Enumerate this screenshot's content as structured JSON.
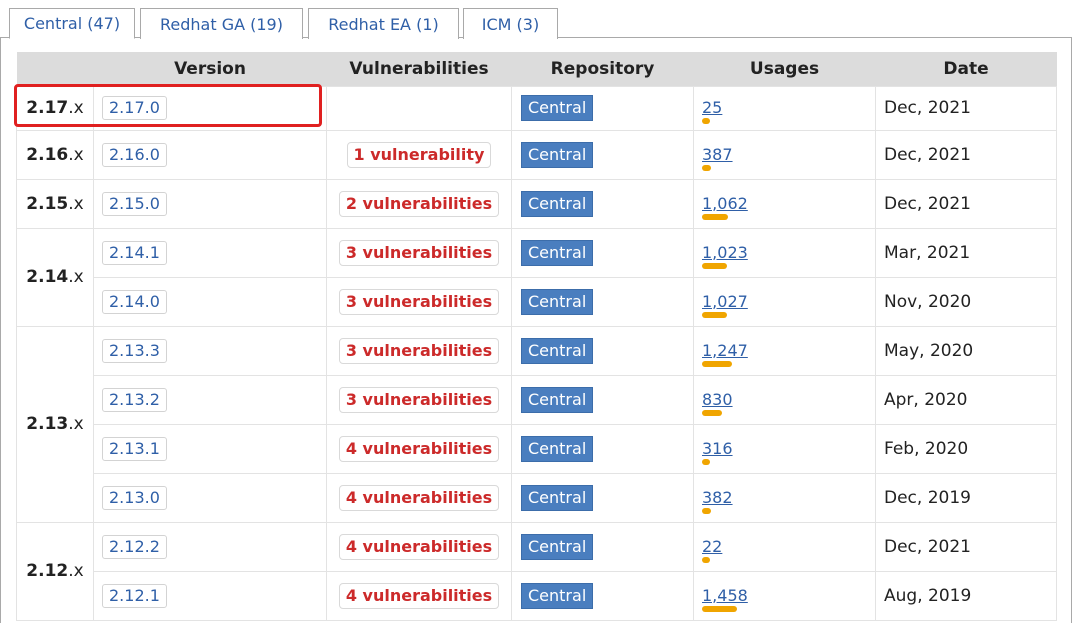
{
  "tabs": [
    {
      "label": "Central (47)"
    },
    {
      "label": "Redhat GA (19)"
    },
    {
      "label": "Redhat EA (1)"
    },
    {
      "label": "ICM (3)"
    }
  ],
  "table": {
    "headers": [
      "Version",
      "Vulnerabilities",
      "Repository",
      "Usages",
      "Date"
    ],
    "rows": [
      {
        "minor": "2.17",
        "version": "2.17.0",
        "vuln": "",
        "repo": "Central",
        "usages": "25",
        "usage_fraction": 0.02,
        "date": "Dec, 2021"
      },
      {
        "minor": "2.16",
        "version": "2.16.0",
        "vuln": "1 vulnerability",
        "repo": "Central",
        "usages": "387",
        "usage_fraction": 0.27,
        "date": "Dec, 2021"
      },
      {
        "minor": "2.15",
        "version": "2.15.0",
        "vuln": "2 vulnerabilities",
        "repo": "Central",
        "usages": "1,062",
        "usage_fraction": 0.73,
        "date": "Dec, 2021"
      },
      {
        "minor": "2.14",
        "version": "2.14.1",
        "vuln": "3 vulnerabilities",
        "repo": "Central",
        "usages": "1,023",
        "usage_fraction": 0.7,
        "date": "Mar, 2021"
      },
      {
        "minor": "",
        "version": "2.14.0",
        "vuln": "3 vulnerabilities",
        "repo": "Central",
        "usages": "1,027",
        "usage_fraction": 0.7,
        "date": "Nov, 2020"
      },
      {
        "minor": "2.13",
        "version": "2.13.3",
        "vuln": "3 vulnerabilities",
        "repo": "Central",
        "usages": "1,247",
        "usage_fraction": 0.86,
        "date": "May, 2020"
      },
      {
        "minor": "",
        "version": "2.13.2",
        "vuln": "3 vulnerabilities",
        "repo": "Central",
        "usages": "830",
        "usage_fraction": 0.57,
        "date": "Apr, 2020"
      },
      {
        "minor": "",
        "version": "2.13.1",
        "vuln": "4 vulnerabilities",
        "repo": "Central",
        "usages": "316",
        "usage_fraction": 0.22,
        "date": "Feb, 2020"
      },
      {
        "minor": "",
        "version": "2.13.0",
        "vuln": "4 vulnerabilities",
        "repo": "Central",
        "usages": "382",
        "usage_fraction": 0.26,
        "date": "Dec, 2019"
      },
      {
        "minor": "2.12",
        "version": "2.12.2",
        "vuln": "4 vulnerabilities",
        "repo": "Central",
        "usages": "22",
        "usage_fraction": 0.015,
        "date": "Dec, 2021"
      },
      {
        "minor": "",
        "version": "2.12.1",
        "vuln": "4 vulnerabilities",
        "repo": "Central",
        "usages": "1,458",
        "usage_fraction": 1.0,
        "date": "Aug, 2019"
      }
    ],
    "minor_suffix": ".x"
  },
  "colors": {
    "link": "#2f5fa7",
    "vuln": "#cc2a2a",
    "repo_badge": "#4a7ebf",
    "usage_bar": "#f0a500",
    "highlight": "#e02020"
  }
}
